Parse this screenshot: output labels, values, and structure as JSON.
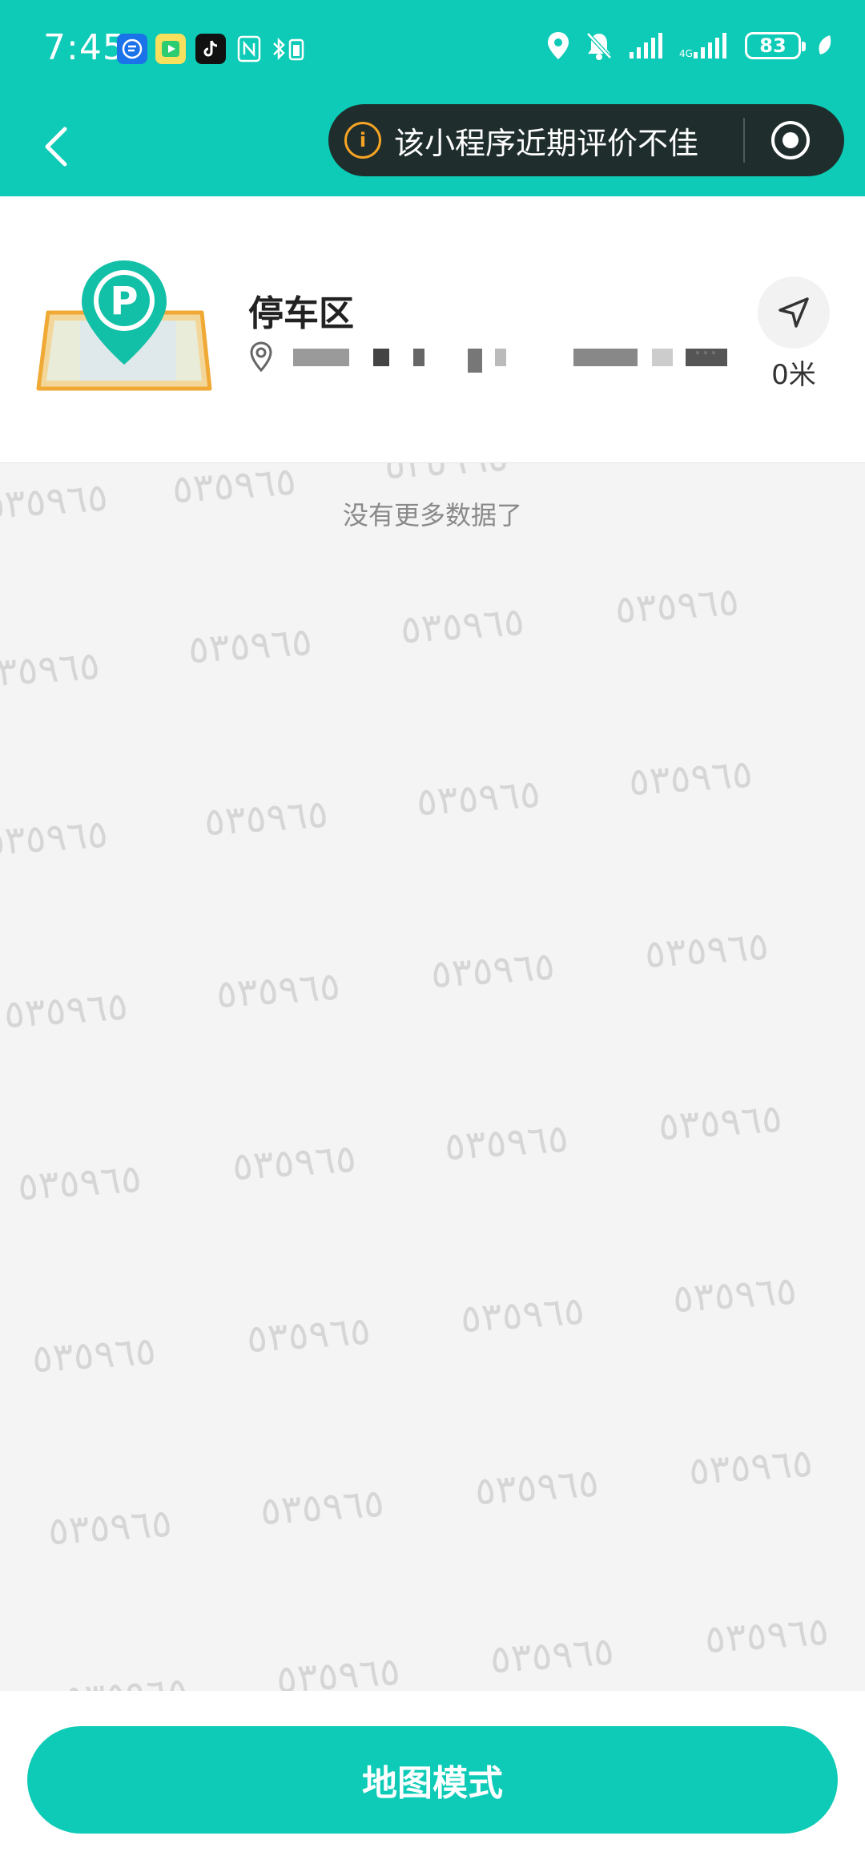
{
  "status_bar": {
    "time": "7:45",
    "battery": "83"
  },
  "header": {
    "notice": "该小程序近期评价不佳"
  },
  "parking": {
    "title": "停车区",
    "distance": "0米"
  },
  "list": {
    "empty_text": "没有更多数据了",
    "watermark": "٥٣٥٩٦٥"
  },
  "bottom": {
    "map_mode_label": "地图模式"
  },
  "colors": {
    "accent": "#0dcbb6",
    "notice_bg": "#1f2d2d",
    "warning": "#f5a423"
  }
}
